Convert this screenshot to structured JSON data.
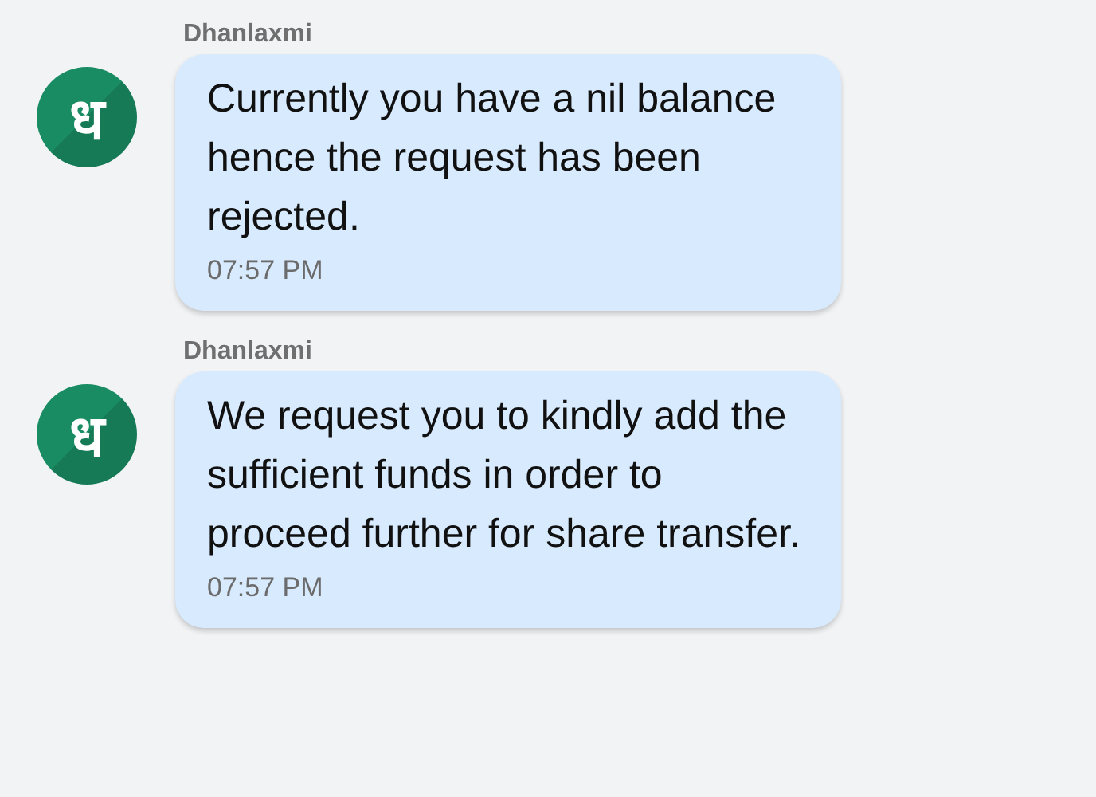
{
  "messages": [
    {
      "sender": "Dhanlaxmi",
      "avatar_text": "ध",
      "text": "Currently you have a nil balance hence the request has been rejected.",
      "time": "07:57 PM"
    },
    {
      "sender": "Dhanlaxmi",
      "avatar_text": "ध",
      "text": "We request you to kindly add the sufficient funds in order to proceed further for share transfer.",
      "time": "07:57 PM"
    }
  ]
}
